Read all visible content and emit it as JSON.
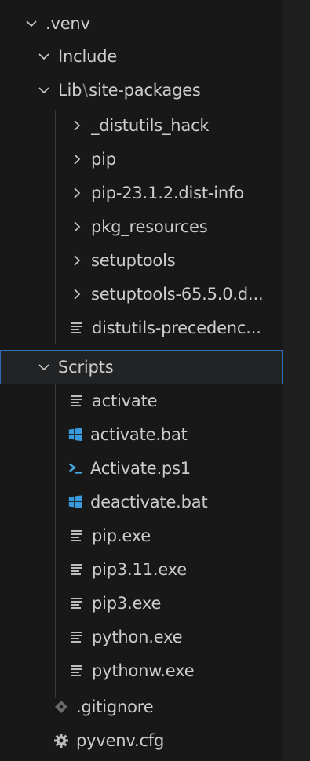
{
  "tree": {
    "root": {
      "label": ".venv",
      "icon": "chevron-down-icon"
    },
    "include": {
      "label": "Include",
      "icon": "chevron-down-icon"
    },
    "lib": {
      "label_start": "Lib",
      "separator": "\\",
      "label_end": "site-packages",
      "icon": "chevron-down-icon"
    },
    "lib_items": [
      {
        "label": "_distutils_hack",
        "icon": "chevron-right-icon"
      },
      {
        "label": "pip",
        "icon": "chevron-right-icon"
      },
      {
        "label": "pip-23.1.2.dist-info",
        "icon": "chevron-right-icon"
      },
      {
        "label": "pkg_resources",
        "icon": "chevron-right-icon"
      },
      {
        "label": "setuptools",
        "icon": "chevron-right-icon"
      },
      {
        "label": "setuptools-65.5.0.d...",
        "icon": "chevron-right-icon"
      },
      {
        "label": "distutils-precedenc...",
        "icon": "text-file-icon"
      }
    ],
    "scripts": {
      "label": "Scripts",
      "icon": "chevron-down-icon",
      "selected": true
    },
    "script_items": [
      {
        "label": "activate",
        "icon": "text-file-icon"
      },
      {
        "label": "activate.bat",
        "icon": "windows-icon"
      },
      {
        "label": "Activate.ps1",
        "icon": "powershell-icon"
      },
      {
        "label": "deactivate.bat",
        "icon": "windows-icon"
      },
      {
        "label": "pip.exe",
        "icon": "text-file-icon"
      },
      {
        "label": "pip3.11.exe",
        "icon": "text-file-icon"
      },
      {
        "label": "pip3.exe",
        "icon": "text-file-icon"
      },
      {
        "label": "python.exe",
        "icon": "text-file-icon"
      },
      {
        "label": "pythonw.exe",
        "icon": "text-file-icon"
      }
    ],
    "root_files": [
      {
        "label": ".gitignore",
        "icon": "git-icon"
      },
      {
        "label": "pyvenv.cfg",
        "icon": "gear-icon"
      }
    ]
  },
  "colors": {
    "background": "#181818",
    "text": "#cccccc",
    "selection_border": "#2f6fb5",
    "windows_icon": "#3a9bdc",
    "powershell_icon": "#4aa8e0"
  }
}
